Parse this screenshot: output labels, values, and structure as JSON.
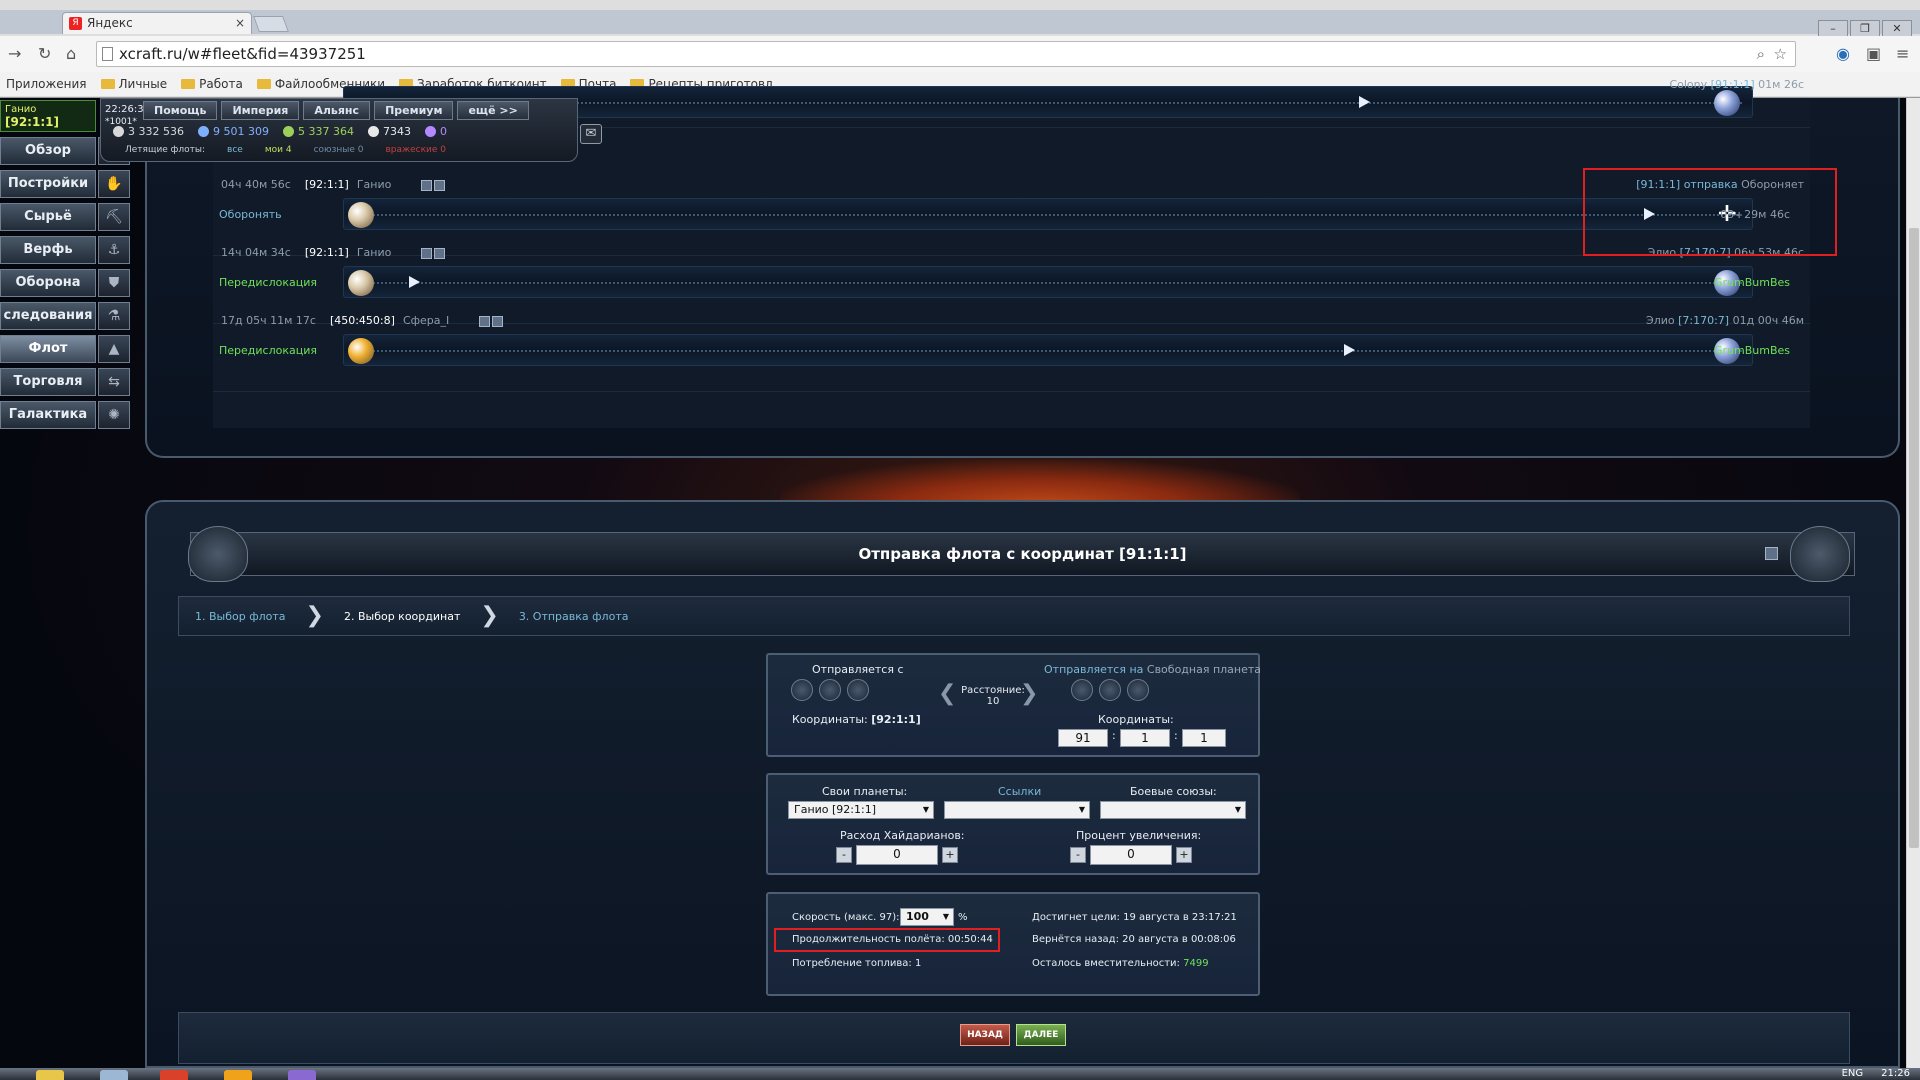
{
  "browser": {
    "tab_title": "Яндекс",
    "tab_icon": "Я",
    "tab_close": "×",
    "win_min": "–",
    "win_max": "❐",
    "win_close": "✕",
    "url": "xcraft.ru/w#fleet&fid=43937251",
    "bookmarks": [
      "Приложения",
      "Личные",
      "Работа",
      "Файлообменники",
      "Заработок биткоинт",
      "Почта",
      "Рецепты приготовл..."
    ]
  },
  "planet_box": {
    "name": "Ганио",
    "coords": "[92:1:1]"
  },
  "clock": {
    "time": "22:26:36",
    "server": "*1001*"
  },
  "top_nav": [
    "Помощь",
    "Империя",
    "Альянс",
    "Премиум",
    "ещё >>"
  ],
  "resources": [
    {
      "value": "3 332 536",
      "color": "#d8d8d8"
    },
    {
      "value": "9 501 309",
      "color": "#7fb0ff"
    },
    {
      "value": "5 337 364",
      "color": "#9bd15a"
    },
    {
      "value": "7343",
      "color": "#e8e8e8"
    },
    {
      "value": "0",
      "color": "#b488ff"
    }
  ],
  "flying_fleets": {
    "label": "Летящие флоты:",
    "all": "все",
    "mine": "мои 4",
    "allied": "союзные 0",
    "enemy": "вражеские 0"
  },
  "side_menu": [
    {
      "label": "Обзор",
      "icon": "rocket-icon"
    },
    {
      "label": "Постройки",
      "icon": "hand-icon"
    },
    {
      "label": "Сырьё",
      "icon": "mine-icon"
    },
    {
      "label": "Верфь",
      "icon": "shipyard-icon"
    },
    {
      "label": "Оборона",
      "icon": "shield-icon"
    },
    {
      "label": "следования",
      "icon": "research-icon"
    },
    {
      "label": "Флот",
      "icon": "fleet-icon",
      "active": true
    },
    {
      "label": "Торговля",
      "icon": "trade-icon"
    },
    {
      "label": "Галактика",
      "icon": "galaxy-icon"
    }
  ],
  "fleets": [
    {
      "left": "",
      "coord": "",
      "owner": "",
      "mission": "",
      "right_top_name": "Colony",
      "right_top_coord": "[91:1:1]",
      "right_top_time": "01м 26с",
      "right_mid": ""
    },
    {
      "left": "04ч 40м 56с",
      "coord": "[92:1:1]",
      "owner": "Ганио",
      "mission": "Оборонять",
      "right_top_name": "[91:1:1] отправка",
      "right_top_coord": "",
      "right_top_time": "Обороняет",
      "right_mid": "03ч 29м 46с"
    },
    {
      "left": "14ч 04м 34с",
      "coord": "[92:1:1]",
      "owner": "Ганио",
      "mission": "Передислокация",
      "right_top_name": "Элио",
      "right_top_coord": "[7:170:7]",
      "right_top_time": "06ч 53м 46с",
      "right_mid": "GrumBumBes"
    },
    {
      "left": "17д 05ч 11м 17с",
      "coord": "[450:450:8]",
      "owner": "Сфера_I",
      "mission": "Передислокация",
      "right_top_name": "Элио",
      "right_top_coord": "[7:170:7]",
      "right_top_time": "01д 00ч 46м",
      "right_mid": "GrumBumBes"
    }
  ],
  "send": {
    "title": "Отправка флота с координат [91:1:1]",
    "steps": [
      "1. Выбор флота",
      "2. Выбор координат",
      "3. Отправка флота"
    ],
    "from_label": "Отправляется с",
    "from_coords_label": "Координаты:",
    "from_coords": "[92:1:1]",
    "distance_label": "Расстояние:",
    "distance": "10",
    "to_label": "Отправляется на",
    "to_target": "Свободная планета",
    "to_coords_label": "Координаты:",
    "to_g": "91",
    "to_s": "1",
    "to_p": "1",
    "own_planets_label": "Свои планеты:",
    "own_planets_value": "Ганио [92:1:1]",
    "links_label": "Ссылки",
    "links_value": "",
    "alliances_label": "Боевые союзы:",
    "alliances_value": "",
    "hydarian_label": "Расход Хайдарианов:",
    "hydarian_value": "0",
    "increase_label": "Процент увеличения:",
    "increase_value": "0",
    "speed_label": "Скорость (макс. 97):",
    "speed_value": "100",
    "speed_unit": "%",
    "duration": "Продолжительность полёта: 00:50:44",
    "fuel": "Потребление топлива: 1",
    "arrive": "Достигнет цели: 19 августа в 23:17:21",
    "return": "Вернётся назад: 20 августа в 00:08:06",
    "capacity_label": "Осталось вместительности:",
    "capacity_value": "7499",
    "back_label": "НАЗАД",
    "next_label": "ДАЛЕЕ"
  },
  "tray": {
    "lang": "ENG",
    "time": "21:26"
  }
}
